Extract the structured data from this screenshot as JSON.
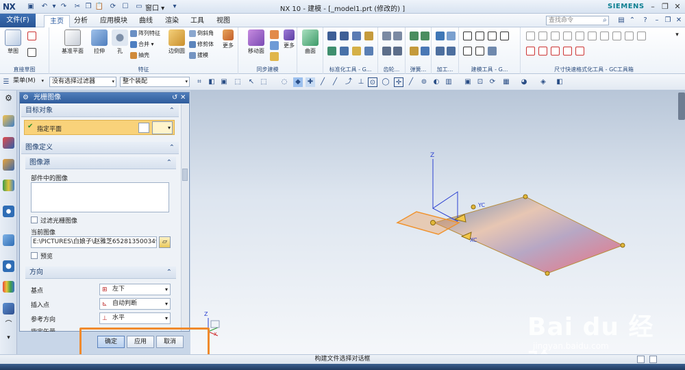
{
  "titlebar": {
    "logo": "NX",
    "window_menu": "窗口",
    "title": "NX 10 - 建模 - [_model1.prt  (修改的) ]",
    "brand": "SIEMENS"
  },
  "menubar": {
    "file_menu": "文件(F)",
    "tabs": [
      {
        "label": "主页"
      },
      {
        "label": "分析"
      },
      {
        "label": "应用模块"
      },
      {
        "label": "曲线"
      },
      {
        "label": "渲染"
      },
      {
        "label": "工具"
      },
      {
        "label": "视图"
      }
    ],
    "search_placeholder": "查找命令"
  },
  "ribbon": {
    "groups": [
      {
        "label": "直接草图",
        "buttons": [
          "草图"
        ]
      },
      {
        "label": "特征",
        "buttons": [
          "基准平面",
          "拉伸",
          "孔",
          "阵列特征",
          "合并",
          "抽壳",
          "边倒圆",
          "倒斜角",
          "修剪体",
          "拔模",
          "更多"
        ]
      },
      {
        "label": "同步建模",
        "buttons": [
          "移动面",
          "更多"
        ]
      },
      {
        "label": "",
        "buttons": [
          "曲面"
        ]
      },
      {
        "label": "标准化工具 - G...",
        "buttons": []
      },
      {
        "label": "齿轮...",
        "buttons": []
      },
      {
        "label": "弹簧...",
        "buttons": []
      },
      {
        "label": "加工...",
        "buttons": []
      },
      {
        "label": "建模工具 - G...",
        "buttons": []
      },
      {
        "label": "尺寸快速格式化工具 - GC工具箱",
        "buttons": []
      }
    ]
  },
  "selection_bar": {
    "menu": "菜单(M)",
    "filter": "没有选择过滤器",
    "scope": "整个装配"
  },
  "dialog": {
    "title": "光栅图像",
    "sections": {
      "target": "目标对象",
      "specify_plane": "指定平面",
      "image_definition": "图像定义",
      "image_source": "图像源",
      "part_images_label": "部件中的图像",
      "filter_raster": "过滤光栅图像",
      "current_image_label": "当前图像",
      "current_image_path": "E:\\PICTURES\\白娘子\\赵雅芝6528135003492",
      "preview": "预览",
      "orientation": "方向",
      "base_point_label": "基点",
      "base_point_value": "左下",
      "insert_point_label": "插入点",
      "insert_point_value": "自动判断",
      "ref_dir_label": "参考方向",
      "ref_dir_value": "水平",
      "specify_vector_label": "指定矢量"
    },
    "buttons": {
      "ok": "确定",
      "apply": "应用",
      "cancel": "取消"
    }
  },
  "graphics": {
    "axis_z": "Z",
    "axis_xc": "XC",
    "axis_yc": "YC",
    "axis_x": "X",
    "axis_y": "Y"
  },
  "status": {
    "text": "构建文件选择对话框"
  },
  "watermark": {
    "text": "Bai du 经验",
    "url": "jingyan.baidu.com"
  }
}
